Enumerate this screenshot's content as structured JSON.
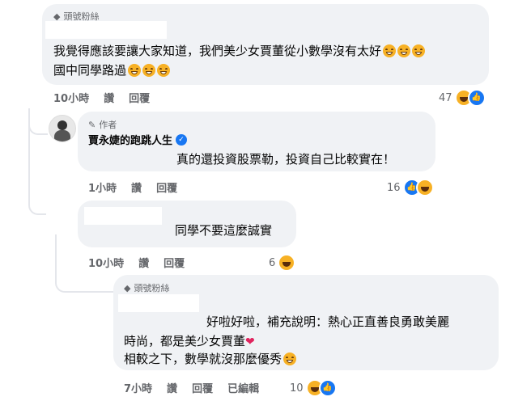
{
  "comments": [
    {
      "badge": "頭號粉絲",
      "lines": [
        "我覺得應該要讓大家知道，我們美少女賈董從小數學沒有太好",
        "國中同學路過"
      ],
      "time": "10小時",
      "like_label": "讚",
      "reply_label": "回覆",
      "reactions_count": "47"
    },
    {
      "author_tag": "作者",
      "author_name": "賈永婕的跑跳人生",
      "lines": [
        "真的還投資股票勒，投資自己比較實在！"
      ],
      "time": "1小時",
      "like_label": "讚",
      "reply_label": "回覆",
      "reactions_count": "16"
    },
    {
      "lines": [
        "同學不要這麼誠實"
      ],
      "time": "10小時",
      "like_label": "讚",
      "reply_label": "回覆",
      "reactions_count": "6"
    },
    {
      "badge": "頭號粉絲",
      "lines": [
        "好啦好啦，補充說明：熱心正直善良勇敢美麗",
        "時尚，都是美少女賈董",
        "相較之下，數學就沒那麼優秀"
      ],
      "time": "7小時",
      "like_label": "讚",
      "reply_label": "回覆",
      "edited_label": "已編輯",
      "reactions_count": "10"
    }
  ],
  "colors": {
    "bubble": "#f0f2f5",
    "meta": "#65676b",
    "accent": "#1877f2",
    "haha": "#f7b125"
  },
  "icons": [
    "diamond-icon",
    "pencil-icon",
    "verified-icon",
    "haha-emoji",
    "like-reaction-icon",
    "heart-emoji"
  ]
}
